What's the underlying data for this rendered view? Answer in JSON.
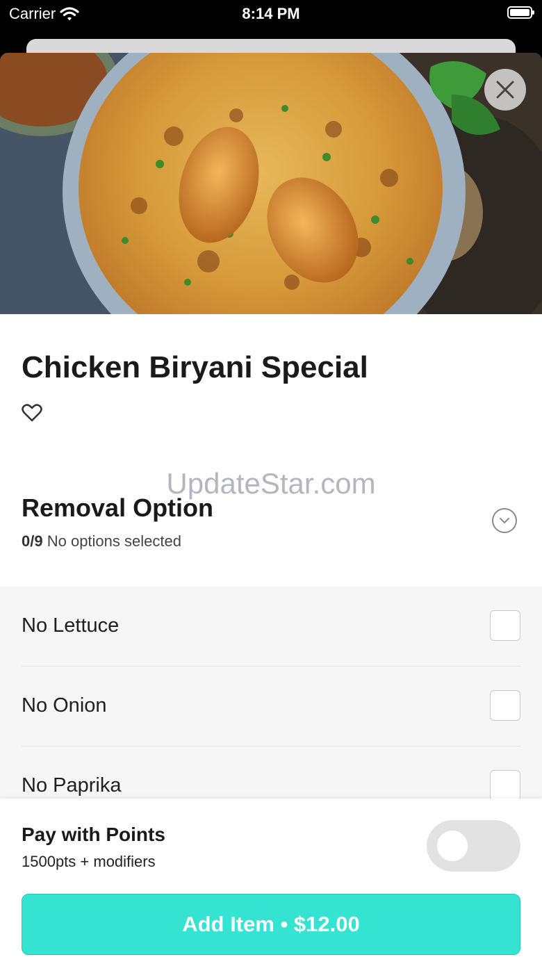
{
  "status_bar": {
    "carrier": "Carrier",
    "time": "8:14 PM"
  },
  "item": {
    "title": "Chicken Biryani Special",
    "image_alt": "chicken-biryani-photo"
  },
  "watermark": "UpdateStar.com",
  "removal_section": {
    "title": "Removal Option",
    "count": "0/9",
    "status": "No options selected",
    "options": [
      {
        "label": "No Lettuce",
        "checked": false
      },
      {
        "label": "No Onion",
        "checked": false
      },
      {
        "label": "No Paprika",
        "checked": false
      }
    ]
  },
  "points": {
    "title": "Pay with Points",
    "subtitle": "1500pts + modifiers",
    "enabled": false
  },
  "add_button": {
    "label": "Add Item • $12.00"
  },
  "colors": {
    "accent": "#35e3d2",
    "toggle_off": "#e2e2e2",
    "options_bg": "#f6f6f6"
  }
}
